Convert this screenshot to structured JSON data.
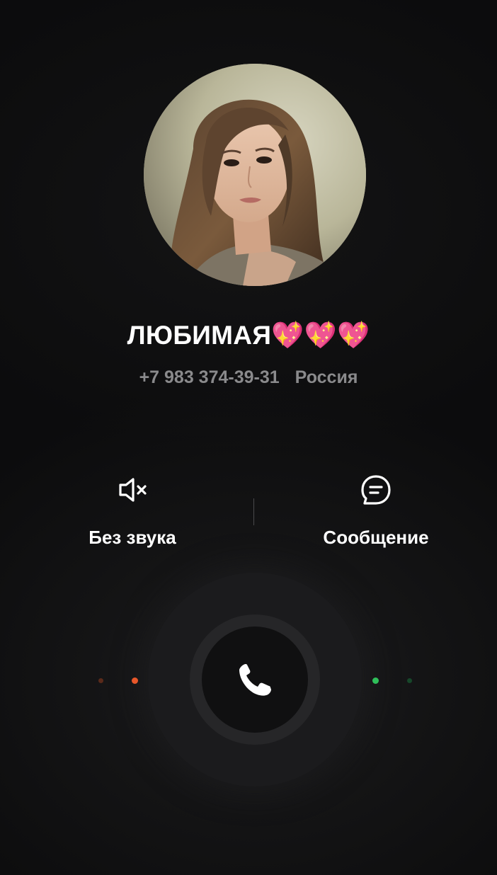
{
  "contact": {
    "name": "ЛЮБИМАЯ",
    "name_emoji": "💖💖💖",
    "phone": "+7 983 374-39-31",
    "country": "Россия"
  },
  "actions": {
    "mute_label": "Без звука",
    "mute_icon": "speaker-mute-icon",
    "message_label": "Сообщение",
    "message_icon": "chat-bubble-icon"
  },
  "answer": {
    "icon": "phone-handset-icon"
  },
  "colors": {
    "background": "#0b0b0c",
    "text_primary": "#ffffff",
    "text_secondary": "#8a8a8c",
    "decline_dot": "#e8572a",
    "accept_dot": "#2fbf5a"
  }
}
